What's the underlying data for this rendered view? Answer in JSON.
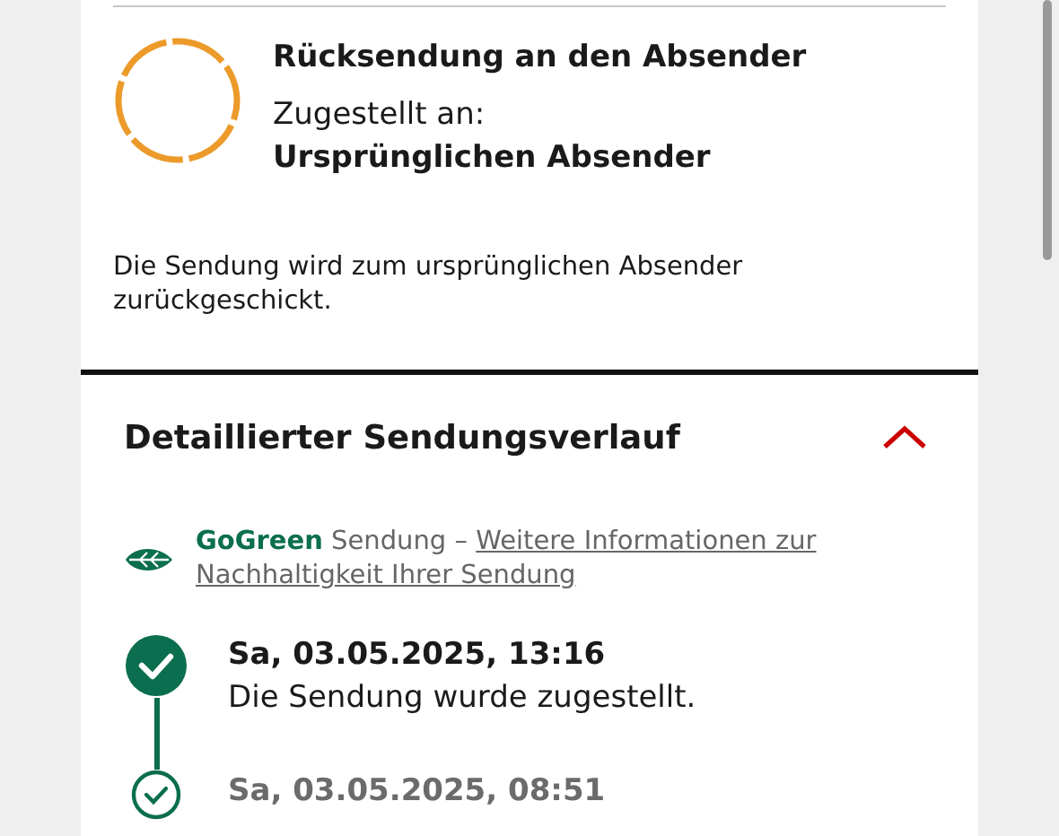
{
  "status": {
    "title": "Rücksendung an den Absender",
    "delivered_label": "Zugestellt an:",
    "recipient": "Ursprünglichen Absender",
    "description": "Die Sendung wird zum ursprünglichen Absender zurückgeschickt."
  },
  "history": {
    "title": "Detaillierter Sendungsverlauf",
    "expanded": true,
    "gogreen": {
      "brand": "GoGreen",
      "text": "Sendung –",
      "link_lines": [
        "Weitere Informationen zur",
        "Nachhaltigkeit Ihrer Sendung"
      ]
    },
    "events": [
      {
        "kind": "latest",
        "date": "Sa, 03.05.2025, 13:16",
        "text": "Die Sendung wurde zugestellt."
      },
      {
        "kind": "earlier",
        "date": "Sa, 03.05.2025, 08:51"
      }
    ]
  }
}
